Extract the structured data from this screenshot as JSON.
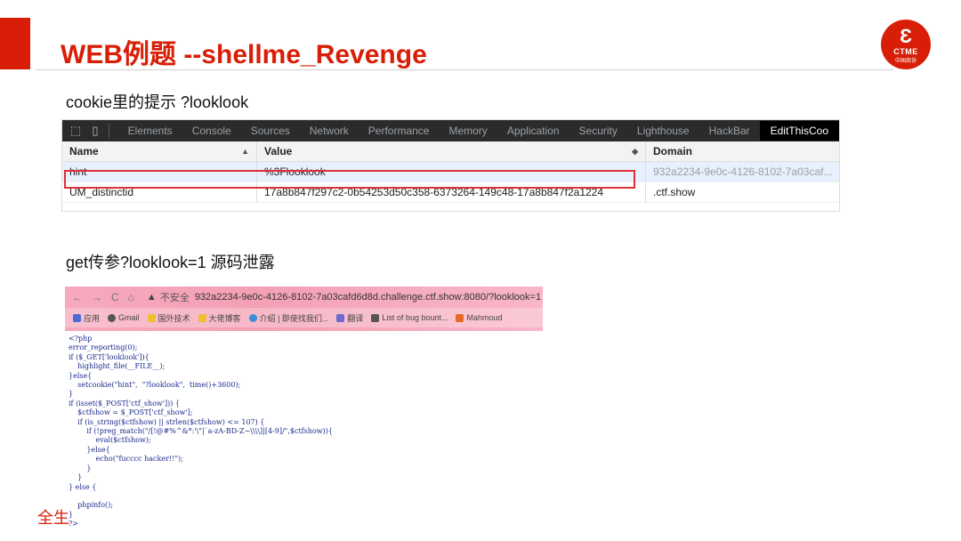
{
  "slide": {
    "title": "WEB例题 --shellme_Revenge",
    "logo": {
      "glyph": "Ɛ",
      "line1": "CTME",
      "line2": "中国商协"
    },
    "caption1": "cookie里的提示 ?looklook",
    "caption2": "get传参?looklook=1 源码泄露",
    "footer": "全生"
  },
  "devtools": {
    "tabs": [
      "Elements",
      "Console",
      "Sources",
      "Network",
      "Performance",
      "Memory",
      "Application",
      "Security",
      "Lighthouse",
      "HackBar",
      "EditThisCoo"
    ],
    "active_tab": "EditThisCoo",
    "columns": {
      "name": "Name",
      "value": "Value",
      "domain": "Domain"
    },
    "rows": [
      {
        "name": "hint",
        "value": "%3Flooklook",
        "domain": "932a2234-9e0c-4126-8102-7a03caf..."
      },
      {
        "name": "UM_distinctid",
        "value": "17a8b847f297c2-0b54253d50c358-6373264-149c48-17a8b847f2a1224",
        "domain": ".ctf.show"
      }
    ]
  },
  "browser": {
    "insecure_label": "不安全",
    "url": "932a2234-9e0c-4126-8102-7a03cafd6d8d.challenge.ctf.show:8080/?looklook=1",
    "bookmarks": [
      "应用",
      "Gmail",
      "国外技术",
      "大佬博客",
      "介绍 | 即使找我们...",
      "翻译",
      "List of bug bount...",
      "Mahmoud"
    ]
  },
  "code_lines": [
    "<?php",
    "error_reporting(0);",
    "if ($_GET['looklook']){",
    "    highlight_file(__FILE__);",
    "}else{",
    "    setcookie(\"hint\",  \"?looklook\",  time()+3600);",
    "}",
    "if (isset($_POST['ctf_show'])) {",
    "    $ctfshow = $_POST['ctf_show'];",
    "    if (is_string($ctfshow) || strlen($ctfshow) <= 107) {",
    "        if (!preg_match(\"/[!@#%^&*:'\\\"|`a-zA-BD-Z~\\\\\\\\]|[4-9]/\",$ctfshow)){",
    "            eval($ctfshow);",
    "        }else{",
    "            echo(\"fucccc hacker!!\");",
    "        }",
    "    }",
    "} else {",
    "",
    "    phpinfo();",
    "}",
    "?>"
  ],
  "colors": {
    "accent": "#d81e06",
    "highlight_box": "#e0303a"
  }
}
